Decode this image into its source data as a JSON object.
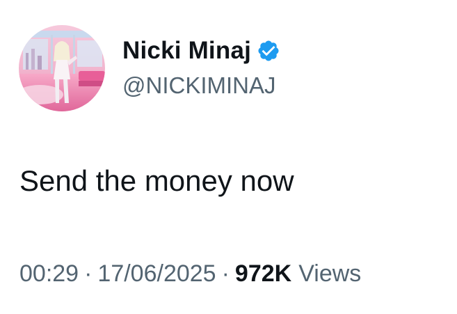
{
  "author": {
    "display_name": "Nicki Minaj",
    "handle": "@NICKIMINAJ",
    "verified_icon": "verified-badge-icon",
    "avatar_icon": "profile-avatar"
  },
  "tweet": {
    "text": "Send the money now"
  },
  "meta": {
    "time": "00:29",
    "separator": "·",
    "date": "17/06/2025",
    "views_count": "972K",
    "views_label": "Views"
  },
  "colors": {
    "text_primary": "#0f1419",
    "text_secondary": "#536471",
    "verified_blue": "#1d9bf0",
    "background": "#ffffff"
  }
}
